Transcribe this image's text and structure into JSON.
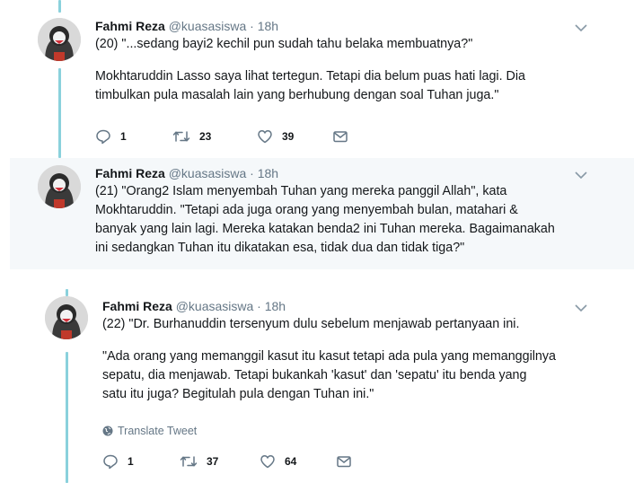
{
  "tweets": [
    {
      "name": "Fahmi Reza",
      "handle": "@kuasasiswa",
      "time": "· 18h",
      "paragraphs": [
        [
          "(20) \"...sedang bayi2 kechil pun sudah tahu belaka membuatnya?\""
        ],
        [
          "Mokhtaruddin Lasso saya lihat tertegun. Tetapi dia belum puas hati lagi. Dia",
          "timbulkan pula masalah lain yang berhubung dengan soal Tuhan juga.\""
        ]
      ],
      "replies": "1",
      "retweets": "23",
      "likes": "39"
    },
    {
      "name": "Fahmi Reza",
      "handle": "@kuasasiswa",
      "time": "· 18h",
      "paragraphs": [
        [
          "(21) \"Orang2 Islam menyembah Tuhan yang mereka panggil Allah\", kata",
          "Mokhtaruddin. \"Tetapi ada juga orang yang menyembah bulan, matahari &",
          "banyak yang lain lagi. Mereka katakan benda2 ini Tuhan mereka. Bagaimanakah",
          "ini sedangkan Tuhan itu dikatakan esa, tidak dua dan tidak tiga?\""
        ]
      ]
    },
    {
      "name": "Fahmi Reza",
      "handle": "@kuasasiswa",
      "time": "· 18h",
      "paragraphs": [
        [
          "(22) \"Dr. Burhanuddin tersenyum dulu sebelum menjawab pertanyaan ini."
        ],
        [
          "\"Ada orang yang memanggil kasut itu kasut tetapi ada pula yang memanggilnya",
          "sepatu, dia menjawab. Tetapi bukankah 'kasut' dan 'sepatu' itu benda yang",
          "satu itu juga? Begitulah pula dengan Tuhan ini.\""
        ]
      ],
      "translate_label": "Translate Tweet",
      "replies": "1",
      "retweets": "37",
      "likes": "64"
    }
  ],
  "colors": {
    "thread_line": "#8ad1dc",
    "highlight_bg": "#f5f8fa",
    "secondary_text": "#657786"
  },
  "icons": {
    "reply": "reply-icon",
    "retweet": "retweet-icon",
    "like": "like-icon",
    "dm": "envelope-icon",
    "caret": "chevron-down-icon",
    "translate": "globe-icon"
  }
}
